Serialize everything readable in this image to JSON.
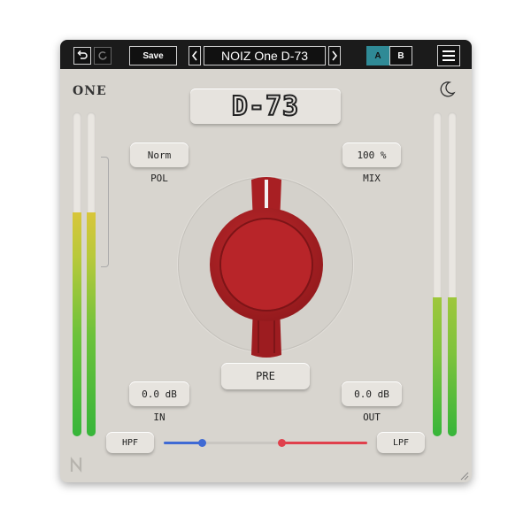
{
  "topbar": {
    "undo_icon": "undo-icon",
    "redo_icon": "redo-icon",
    "save_label": "Save",
    "prev_icon": "chevron-left-icon",
    "preset_name": "NOIZ One D-73",
    "next_icon": "chevron-right-icon",
    "ab_a_label": "A",
    "ab_b_label": "B",
    "active_ab": "A",
    "menu_icon": "hamburger-menu-icon",
    "accent_color": "#2f8a96"
  },
  "header": {
    "logo_text": "ONE",
    "theme_icon": "moon-icon",
    "title": "D-73"
  },
  "controls": {
    "polarity": {
      "value": "Norm",
      "label": "POL"
    },
    "mix": {
      "value": "100 %",
      "label": "MIX"
    },
    "pre_button": "PRE",
    "input_gain": {
      "value": "0.0 dB",
      "label": "IN"
    },
    "output_gain": {
      "value": "0.0 dB",
      "label": "OUT"
    },
    "hpf_button": "HPF",
    "lpf_button": "LPF"
  },
  "meters": {
    "input_left_level": 0.69,
    "input_right_level": 0.69,
    "output_left_level": 0.43,
    "output_right_level": 0.43
  },
  "filter": {
    "hpf_position": 0.19,
    "lpf_position": 0.58,
    "hpf_color": "#3f6ad4",
    "lpf_color": "#e0404c"
  },
  "knob": {
    "color": "#b52226",
    "icon": "pre-gain-knob"
  },
  "brand_icon": "noiz-n-logo-icon",
  "resize_icon": "resize-grip-icon"
}
